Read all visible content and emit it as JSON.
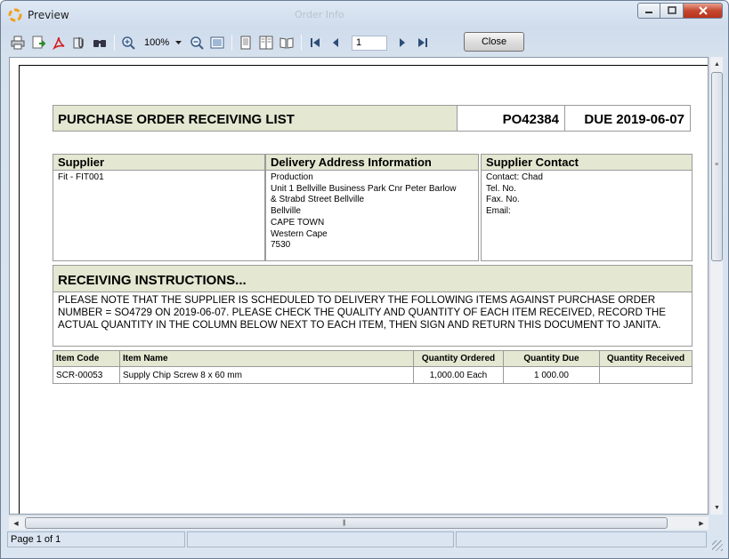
{
  "window": {
    "title": "Preview",
    "background_title": "Order Info"
  },
  "toolbar": {
    "zoom": "100%",
    "page_number": "1",
    "close_label": "Close"
  },
  "report": {
    "title": "PURCHASE ORDER RECEIVING LIST",
    "po_number": "PO42384",
    "due": "DUE 2019-06-07",
    "supplier": {
      "heading": "Supplier",
      "value": "Fit -  FIT001"
    },
    "delivery": {
      "heading": "Delivery Address Information",
      "lines": [
        "Production",
        "Unit 1 Bellville Business Park Cnr Peter Barlow",
        "& Strabd Street Bellville",
        "Bellville",
        "CAPE TOWN",
        "Western Cape",
        "7530"
      ]
    },
    "contact": {
      "heading": "Supplier Contact",
      "lines": [
        "Contact: Chad",
        "Tel. No.",
        "Fax. No.",
        "Email:"
      ]
    },
    "instructions": {
      "heading": "RECEIVING INSTRUCTIONS...",
      "text": "PLEASE NOTE THAT THE SUPPLIER IS SCHEDULED TO DELIVERY THE FOLLOWING ITEMS AGAINST PURCHASE ORDER NUMBER = SO4729 ON 2019-06-07.  PLEASE CHECK THE QUALITY AND QUANTITY OF EACH ITEM RECEIVED, RECORD THE ACTUAL QUANTITY IN THE COLUMN BELOW NEXT TO EACH ITEM, THEN SIGN AND RETURN THIS DOCUMENT TO JANITA."
    },
    "table": {
      "headers": [
        "Item Code",
        "Item Name",
        "Quantity Ordered",
        "Quantity Due",
        "Quantity Received"
      ],
      "rows": [
        [
          "SCR-00053",
          "Supply Chip Screw 8 x 60 mm",
          "1,000.00 Each",
          "1 000.00",
          ""
        ]
      ]
    }
  },
  "status": {
    "page": "Page 1 of 1"
  },
  "icons": [
    "app-icon",
    "print-icon",
    "export-icon",
    "pdf-icon",
    "attach-icon",
    "find-icon",
    "zoom-in-icon",
    "zoom-out-icon",
    "fit-page-icon",
    "single-page-icon",
    "multi-page-icon",
    "book-icon",
    "first-page-icon",
    "previous-page-icon",
    "next-page-icon",
    "last-page-icon"
  ]
}
